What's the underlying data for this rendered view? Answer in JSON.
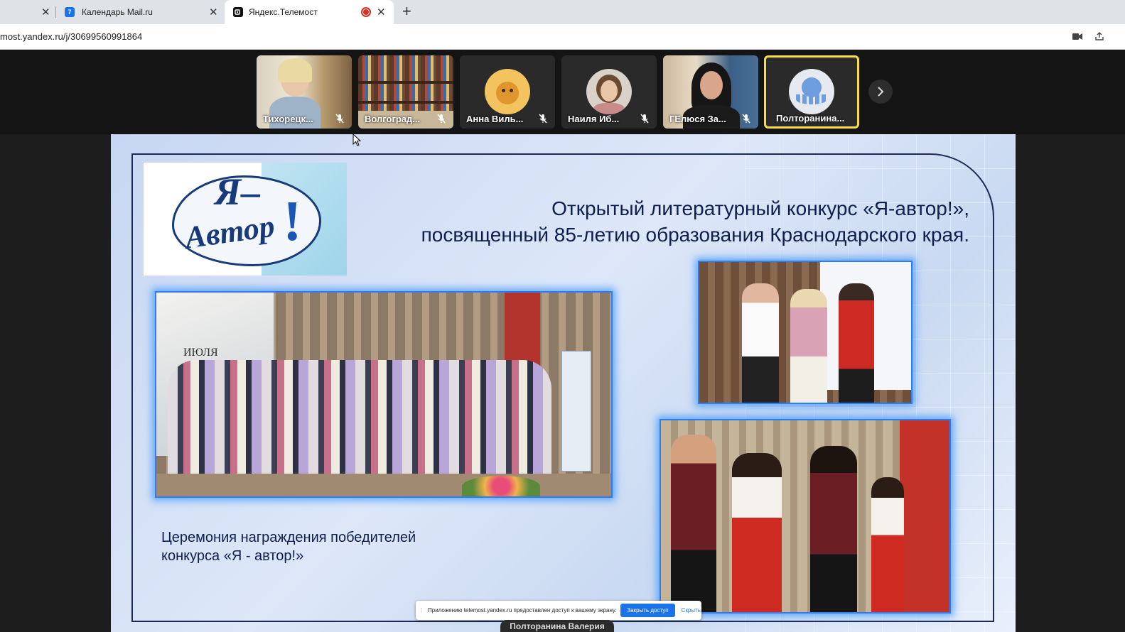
{
  "browser": {
    "tabs": [
      {
        "title": "",
        "favicon": "",
        "active": false
      },
      {
        "title": "Календарь Mail.ru",
        "favicon": "calendar-icon",
        "favicon_text": "7",
        "active": false
      },
      {
        "title": "Яндекс.Телемост",
        "favicon": "telemost-icon",
        "active": true,
        "recording": true
      }
    ],
    "url": "most.yandex.ru/j/30699560991864"
  },
  "participants": [
    {
      "name": "Тихорецк...",
      "muted": true,
      "type": "video"
    },
    {
      "name": "Волгоград...",
      "muted": true,
      "type": "video"
    },
    {
      "name": "Анна Виль...",
      "muted": true,
      "type": "avatar",
      "avatar": "lion-avatar"
    },
    {
      "name": "Наиля Иб...",
      "muted": true,
      "type": "avatar",
      "avatar": "photo-avatar"
    },
    {
      "name": "ГЕлюся За...",
      "muted": true,
      "type": "video"
    },
    {
      "name": "Полторанина...",
      "muted": false,
      "type": "avatar",
      "avatar": "octopus-avatar",
      "speaking": true
    }
  ],
  "slide": {
    "logo_text": "Я-Автор!",
    "title_line1": "Открытый литературный конкурс «Я-автор!»,",
    "title_line2": "посвященный 85-летию образования Краснодарского края.",
    "caption_line1": "Церемония награждения победителей",
    "caption_line2": "конкурса «Я - автор!»",
    "stage_text": "ИЮЛЯ"
  },
  "share_banner": {
    "message": "Приложению telemost.yandex.ru предоставлен доступ к вашему экрану.",
    "stop_label": "Закрыть доступ",
    "hide_label": "Скрыть"
  },
  "presenter": "Полторанина Валерия",
  "colors": {
    "speaking_border": "#f7dc4a",
    "photo_glow": "#3a96ff",
    "title_text": "#0e1f4d",
    "share_button": "#1a73e8"
  }
}
